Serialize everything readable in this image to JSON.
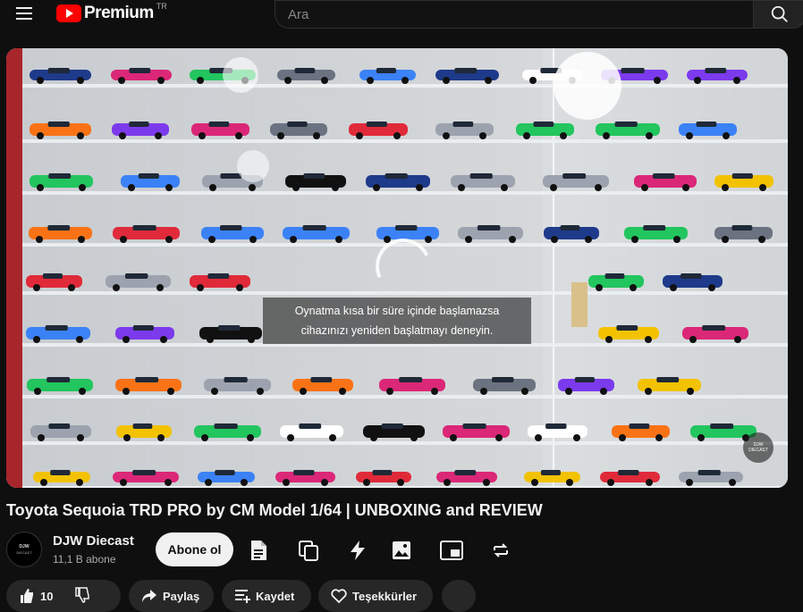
{
  "header": {
    "logo_text": "Premium",
    "region": "TR",
    "search_placeholder": "Ara"
  },
  "player": {
    "notice_line1": "Oynatma kısa bir süre içinde başlamazsa",
    "notice_line2": "cihazınızı yeniden başlatmayı deneyin.",
    "watermark_line1": "DJW",
    "watermark_line2": "DIECAST"
  },
  "video": {
    "title": "Toyota Sequoia TRD PRO by CM Model 1/64 | UNBOXING and REVIEW"
  },
  "channel": {
    "name": "DJW Diecast",
    "subscribers": "11,1 B abone",
    "avatar_line1": "DJW",
    "avatar_line2": "DIECAST",
    "subscribe_label": "Abone ol"
  },
  "actions": {
    "like_count": "10",
    "share_label": "Paylaş",
    "save_label": "Kaydet",
    "thanks_label": "Teşekkürler"
  },
  "colors": {
    "background": "#0f0f0f",
    "brand_red": "#ff0000",
    "pill_bg": "#272727"
  }
}
